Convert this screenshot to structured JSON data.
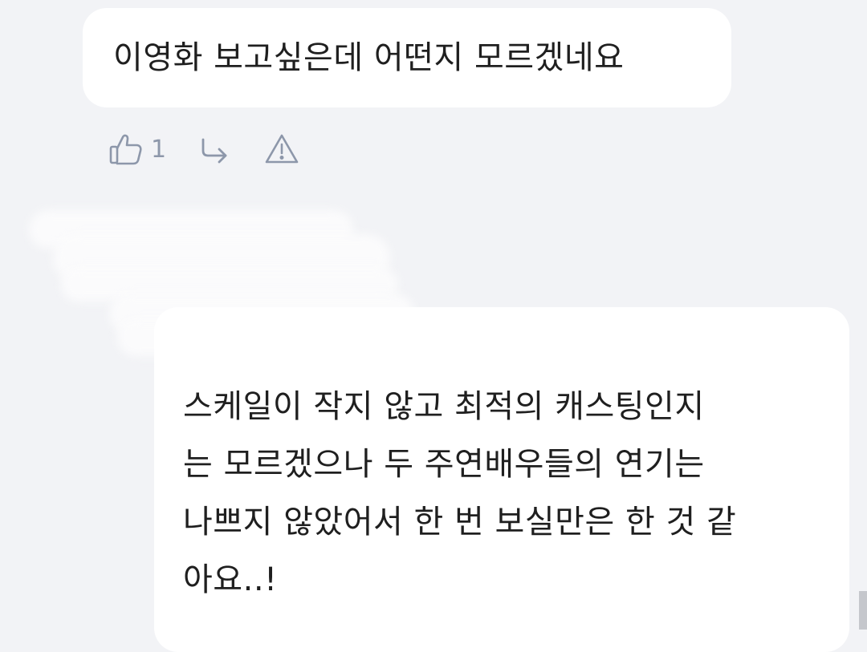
{
  "comment": {
    "text": "이영화 보고싶은데 어떤지 모르겠네요",
    "likes": "1",
    "icons": {
      "like": "thumbs-up-icon",
      "reply": "reply-arrow-icon",
      "report": "warning-triangle-icon"
    }
  },
  "reply": {
    "text": "스케일이 작지 않고 최적의 캐스팅인지\n는 모르겠으나 두 주연배우들의 연기는\n나쁘지 않았어서 한 번 보실만은 한 것 같\n아요..!"
  },
  "colors": {
    "background": "#f2f3f6",
    "bubble": "#ffffff",
    "icon": "#8d97aa"
  }
}
